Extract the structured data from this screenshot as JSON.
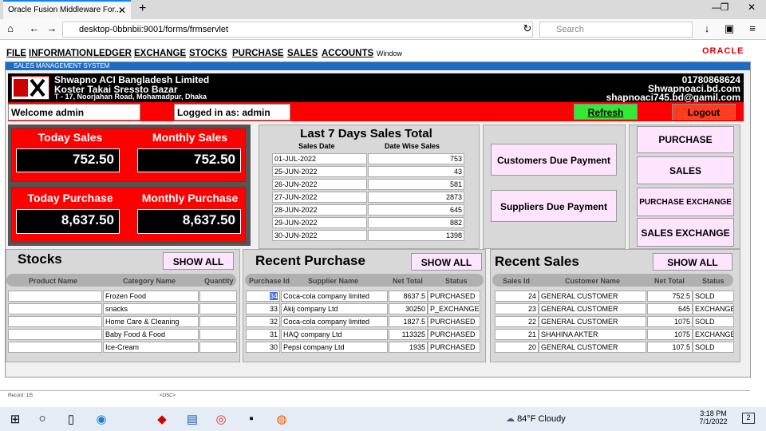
{
  "browser": {
    "tab_title": "Oracle Fusion Middleware For...",
    "url": "desktop-0bbnbii:9001/forms/frmservlet",
    "search_placeholder": "Search"
  },
  "menu": [
    "FILE",
    "INFORMATION",
    "LEDGER",
    "EXCHANGE",
    "STOCKS",
    "PURCHASE",
    "SALES",
    "ACCOUNTS"
  ],
  "menu_window": "Window",
  "oracle": "ORACLE",
  "frame_title": "SALES MANAGEMENT SYSTEM",
  "company": {
    "name": "Shwapno ACI Bangladesh Limited",
    "line2": "Koster Takai Sressto Bazar",
    "line3": "T - 17, Noorjahan Road, Mohamadpur, Dhaka",
    "phone": "01780868624",
    "web": "Shwapnoaci.bd.com",
    "email": "shapnoaci745.bd@gamil.com"
  },
  "welcome": "Welcome admin",
  "logged": "Logged in as: admin",
  "refresh": "Refresh",
  "logout": "Logout",
  "cards": {
    "today_sales_label": "Today Sales",
    "today_sales": "752.50",
    "monthly_sales_label": "Monthly Sales",
    "monthly_sales": "752.50",
    "today_purchase_label": "Today Purchase",
    "today_purchase": "8,637.50",
    "monthly_purchase_label": "Monthly Purchase",
    "monthly_purchase": "8,637.50"
  },
  "last7": {
    "title": "Last 7 Days Sales Total",
    "col1": "Sales Date",
    "col2": "Date Wise Sales",
    "rows": [
      [
        "01-JUL-2022",
        "753"
      ],
      [
        "25-JUN-2022",
        "43"
      ],
      [
        "26-JUN-2022",
        "581"
      ],
      [
        "27-JUN-2022",
        "2873"
      ],
      [
        "28-JUN-2022",
        "645"
      ],
      [
        "29-JUN-2022",
        "882"
      ],
      [
        "30-JUN-2022",
        "1398"
      ]
    ]
  },
  "due": {
    "customers": "Customers Due Payment",
    "suppliers": "Suppliers Due Payment"
  },
  "quick": [
    "PURCHASE",
    "SALES",
    "PURCHASE EXCHANGE",
    "SALES EXCHANGE"
  ],
  "stocks": {
    "title": "Stocks",
    "show_all": "SHOW ALL",
    "cols": [
      "Product Name",
      "Category Name",
      "Quantity"
    ],
    "rows": [
      [
        "",
        "Frozen Food",
        ""
      ],
      [
        "",
        "snacks",
        ""
      ],
      [
        "",
        "Home Care & Cleaning",
        ""
      ],
      [
        "",
        "Baby Food & Food",
        ""
      ],
      [
        "",
        "Ice-Cream",
        ""
      ]
    ]
  },
  "purchase": {
    "title": "Recent Purchase",
    "show_all": "SHOW ALL",
    "cols": [
      "Purchase Id",
      "Supplier Name",
      "Net Total",
      "Status"
    ],
    "rows": [
      [
        "34",
        "Coca-cola company limited",
        "8637.5",
        "PURCHASED"
      ],
      [
        "33",
        "Akij company Ltd",
        "30250",
        "P_EXCHANGE"
      ],
      [
        "32",
        "Coca-cola company limited",
        "1827.5",
        "PURCHASED"
      ],
      [
        "31",
        "HAQ company Ltd",
        "113325",
        "PURCHASED"
      ],
      [
        "30",
        "Pepsi company Ltd",
        "1935",
        "PURCHASED"
      ]
    ]
  },
  "sales": {
    "title": "Recent Sales",
    "show_all": "SHOW ALL",
    "cols": [
      "Sales Id",
      "Customer Name",
      "Net Total",
      "Status"
    ],
    "rows": [
      [
        "24",
        "GENERAL CUSTOMER",
        "752.5",
        "SOLD"
      ],
      [
        "23",
        "GENERAL CUSTOMER",
        "645",
        "EXCHANGE"
      ],
      [
        "22",
        "GENERAL CUSTOMER",
        "1075",
        "SOLD"
      ],
      [
        "21",
        "SHAHINA AKTER",
        "1075",
        "EXCHANGE"
      ],
      [
        "20",
        "GENERAL CUSTOMER",
        "107.5",
        "SOLD"
      ]
    ]
  },
  "statusbar": {
    "record": "Record: 1/5",
    "osc": "<OSC>"
  },
  "taskbar": {
    "weather": "84°F Cloudy",
    "time": "3:18 PM",
    "date": "7/1/2022",
    "notif": "2"
  }
}
